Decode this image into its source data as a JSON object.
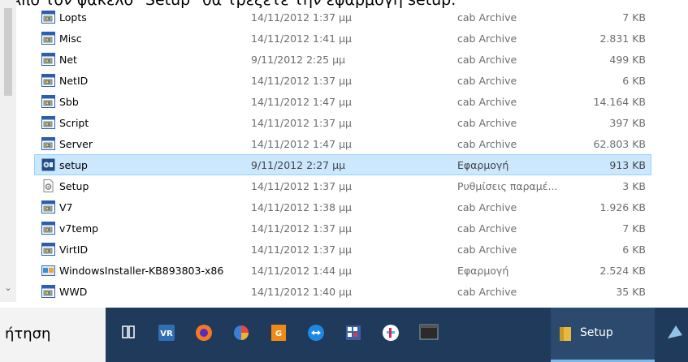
{
  "caption": "- Από τον φάκελο \"Setup\" θα τρέξετε την εφαρμογή setup.",
  "files": [
    {
      "name": "Lopts",
      "date": "14/11/2012 1:37 μμ",
      "type": "cab Archive",
      "size": "7 KB",
      "icon": "cab-archive-icon"
    },
    {
      "name": "Misc",
      "date": "14/11/2012 1:41 μμ",
      "type": "cab Archive",
      "size": "2.831 KB",
      "icon": "cab-archive-icon"
    },
    {
      "name": "Net",
      "date": "9/11/2012 2:25 μμ",
      "type": "cab Archive",
      "size": "499 KB",
      "icon": "cab-archive-icon"
    },
    {
      "name": "NetID",
      "date": "14/11/2012 1:37 μμ",
      "type": "cab Archive",
      "size": "6 KB",
      "icon": "cab-archive-icon"
    },
    {
      "name": "Sbb",
      "date": "14/11/2012 1:47 μμ",
      "type": "cab Archive",
      "size": "14.164 KB",
      "icon": "cab-archive-icon"
    },
    {
      "name": "Script",
      "date": "14/11/2012 1:37 μμ",
      "type": "cab Archive",
      "size": "397 KB",
      "icon": "cab-archive-icon"
    },
    {
      "name": "Server",
      "date": "14/11/2012 1:47 μμ",
      "type": "cab Archive",
      "size": "62.803 KB",
      "icon": "cab-archive-icon"
    },
    {
      "name": "setup",
      "date": "9/11/2012 2:27 μμ",
      "type": "Εφαρμογή",
      "size": "913 KB",
      "icon": "setup-exe-icon",
      "selected": true
    },
    {
      "name": "Setup",
      "date": "14/11/2012 1:37 μμ",
      "type": "Ρυθμίσεις παραμέ...",
      "size": "3 KB",
      "icon": "settings-file-icon"
    },
    {
      "name": "V7",
      "date": "14/11/2012 1:38 μμ",
      "type": "cab Archive",
      "size": "1.926 KB",
      "icon": "cab-archive-icon"
    },
    {
      "name": "v7temp",
      "date": "14/11/2012 1:37 μμ",
      "type": "cab Archive",
      "size": "7 KB",
      "icon": "cab-archive-icon"
    },
    {
      "name": "VirtID",
      "date": "14/11/2012 1:37 μμ",
      "type": "cab Archive",
      "size": "6 KB",
      "icon": "cab-archive-icon"
    },
    {
      "name": "WindowsInstaller-KB893803-x86",
      "date": "14/11/2012 1:44 μμ",
      "type": "Εφαρμογή",
      "size": "2.524 KB",
      "icon": "installer-exe-icon"
    },
    {
      "name": "WWD",
      "date": "14/11/2012 1:40 μμ",
      "type": "cab Archive",
      "size": "35 KB",
      "icon": "cab-archive-icon"
    }
  ],
  "taskbar": {
    "search_text": "ήτηση",
    "setup_app_label": "Setup",
    "pinned_icons": [
      "task-view-icon",
      "vr-app-icon",
      "firefox-icon",
      "pie-app-icon",
      "pdf-app-icon",
      "teamviewer-icon",
      "calculator-icon",
      "slack-icon",
      "terminal-icon"
    ],
    "background_color": "#1f3a5a"
  }
}
